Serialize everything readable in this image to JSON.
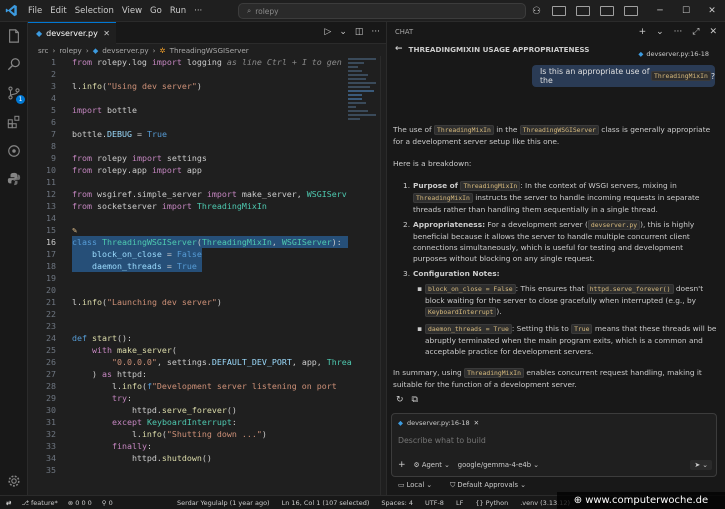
{
  "menu": [
    "File",
    "Edit",
    "Selection",
    "View",
    "Go",
    "Run"
  ],
  "search": {
    "placeholder": "rolepy"
  },
  "editor": {
    "tab": "devserver.py",
    "breadcrumb": [
      "src",
      "rolepy",
      "devserver.py",
      "ThreadingWSGIServer"
    ],
    "lines": [
      {
        "n": 1,
        "html": "<span class='k'>from</span> rolepy.log <span class='k'>import</span> logging <span class='g'>as line Ctrl + I to gen</span>"
      },
      {
        "n": 2,
        "html": ""
      },
      {
        "n": 3,
        "html": "l.<span class='f'>info</span>(<span class='s'>\"Using dev server\"</span>)"
      },
      {
        "n": 4,
        "html": ""
      },
      {
        "n": 5,
        "html": "<span class='k'>import</span> bottle"
      },
      {
        "n": 6,
        "html": ""
      },
      {
        "n": 7,
        "html": "bottle.<span class='v'>DEBUG</span> = <span class='b'>True</span>"
      },
      {
        "n": 8,
        "html": ""
      },
      {
        "n": 9,
        "html": "<span class='k'>from</span> rolepy <span class='k'>import</span> settings"
      },
      {
        "n": 10,
        "html": "<span class='k'>from</span> rolepy.app <span class='k'>import</span> app"
      },
      {
        "n": 11,
        "html": ""
      },
      {
        "n": 12,
        "html": "<span class='k'>from</span> wsgiref.simple_server <span class='k'>import</span> make_server, <span class='t'>WSGIServ</span>"
      },
      {
        "n": 13,
        "html": "<span class='k'>from</span> socketserver <span class='k'>import</span> <span class='t'>ThreadingMixIn</span>"
      },
      {
        "n": 14,
        "html": ""
      },
      {
        "n": 15,
        "html": "<span style='color:#e2c08d'>✎</span>"
      },
      {
        "n": 16,
        "html": "<span class='b'>class</span> <span class='t'>ThreadingWSGIServer</span>(<span class='t'>ThreadingMixIn</span>, <span class='t'>WSGIServer</span>):"
      },
      {
        "n": 17,
        "html": "    <span class='v'>block_on_close</span> = <span class='b'>False</span>"
      },
      {
        "n": 18,
        "html": "    <span class='v'>daemon_threads</span> = <span class='b'>True</span>"
      },
      {
        "n": 19,
        "html": ""
      },
      {
        "n": 20,
        "html": ""
      },
      {
        "n": 21,
        "html": "l.<span class='f'>info</span>(<span class='s'>\"Launching dev server\"</span>)"
      },
      {
        "n": 22,
        "html": ""
      },
      {
        "n": 23,
        "html": ""
      },
      {
        "n": 24,
        "html": "<span class='b'>def</span> <span class='f'>start</span>():"
      },
      {
        "n": 25,
        "html": "    <span class='k'>with</span> <span class='f'>make_server</span>("
      },
      {
        "n": 26,
        "html": "        <span class='s'>\"0.0.0.0\"</span>, settings.<span class='v'>DEFAULT_DEV_PORT</span>, app, <span class='t'>Threa</span>"
      },
      {
        "n": 27,
        "html": "    ) <span class='k'>as</span> httpd:"
      },
      {
        "n": 28,
        "html": "        l.<span class='f'>info</span>(<span class='b'>f</span><span class='s'>\"Development server listening on port </span>"
      },
      {
        "n": 29,
        "html": "        <span class='k'>try</span>:"
      },
      {
        "n": 30,
        "html": "            httpd.<span class='f'>serve_forever</span>()"
      },
      {
        "n": 31,
        "html": "        <span class='k'>except</span> <span class='t'>KeyboardInterrupt</span>:"
      },
      {
        "n": 32,
        "html": "            l.<span class='f'>info</span>(<span class='s'>\"Shutting down ...\"</span>)"
      },
      {
        "n": 33,
        "html": "        <span class='k'>finally</span>:"
      },
      {
        "n": 34,
        "html": "            httpd.<span class='f'>shutdown</span>()"
      },
      {
        "n": 35,
        "html": ""
      }
    ]
  },
  "chat": {
    "header": "CHAT",
    "title": "THREADINGMIXIN USAGE APPROPRIATENESS",
    "file_chip": "devserver.py:16-18",
    "user_message": "Is this an appropriate use of the ThreadingMixIn?",
    "resp_intro": "The use of <span class='ic-code'>ThreadingMixIn</span> in the <span class='ic-code'>ThreadingWSGIServer</span> class is generally appropriate for a development server setup like this one.",
    "resp_breakdown": "Here is a breakdown:",
    "items": [
      {
        "num": "1.",
        "html": "<b>Purpose of</b> <span class='ic-code'>ThreadingMixIn</span>: In the context of WSGI servers, mixing in <span class='ic-code'>ThreadingMixIn</span> instructs the server to handle incoming requests in separate threads rather than handling them sequentially in a single thread."
      },
      {
        "num": "2.",
        "html": "<b>Appropriateness:</b> For a development server (<span class='ic-code'>devserver.py</span>), this is highly beneficial because it allows the server to handle multiple concurrent client connections simultaneously, which is useful for testing and development purposes without blocking on any single request."
      },
      {
        "num": "3.",
        "html": "<b>Configuration Notes:</b>"
      }
    ],
    "subitems": [
      {
        "html": "<span class='ic-code'>block_on_close = False</span>: This ensures that <span class='ic-code'>httpd.serve_forever()</span> doesn't block waiting for the server to close gracefully when interrupted (e.g., by <span class='ic-code'>KeyboardInterrupt</span>)."
      },
      {
        "html": "<span class='ic-code'>daemon_threads = True</span>: Setting this to <span class='ic-code'>True</span> means that these threads will be abruptly terminated when the main program exits, which is a common and acceptable practice for development servers."
      }
    ],
    "summary": "In summary, using <span class='ic-code'>ThreadingMixIn</span> enables concurrent request handling, making it suitable for the function of a development server.",
    "input_chip": "devserver.py:16-18",
    "input_placeholder": "Describe what to build",
    "mode": "Agent",
    "model": "google/gemma-4-e4b",
    "footer_local": "Local",
    "footer_approvals": "Default Approvals"
  },
  "status": {
    "branch": "feature*",
    "problems": "0 0 0",
    "warnings": "0",
    "blame": "Serdar Yegulalp (1 year ago)",
    "cursor": "Ln 16, Col 1 (107 selected)",
    "spaces": "Spaces: 4",
    "encoding": "UTF-8",
    "eol": "LF",
    "language": "Python",
    "venv": ".venv (3.13.12)"
  },
  "watermark": "www.computerwoche.de"
}
